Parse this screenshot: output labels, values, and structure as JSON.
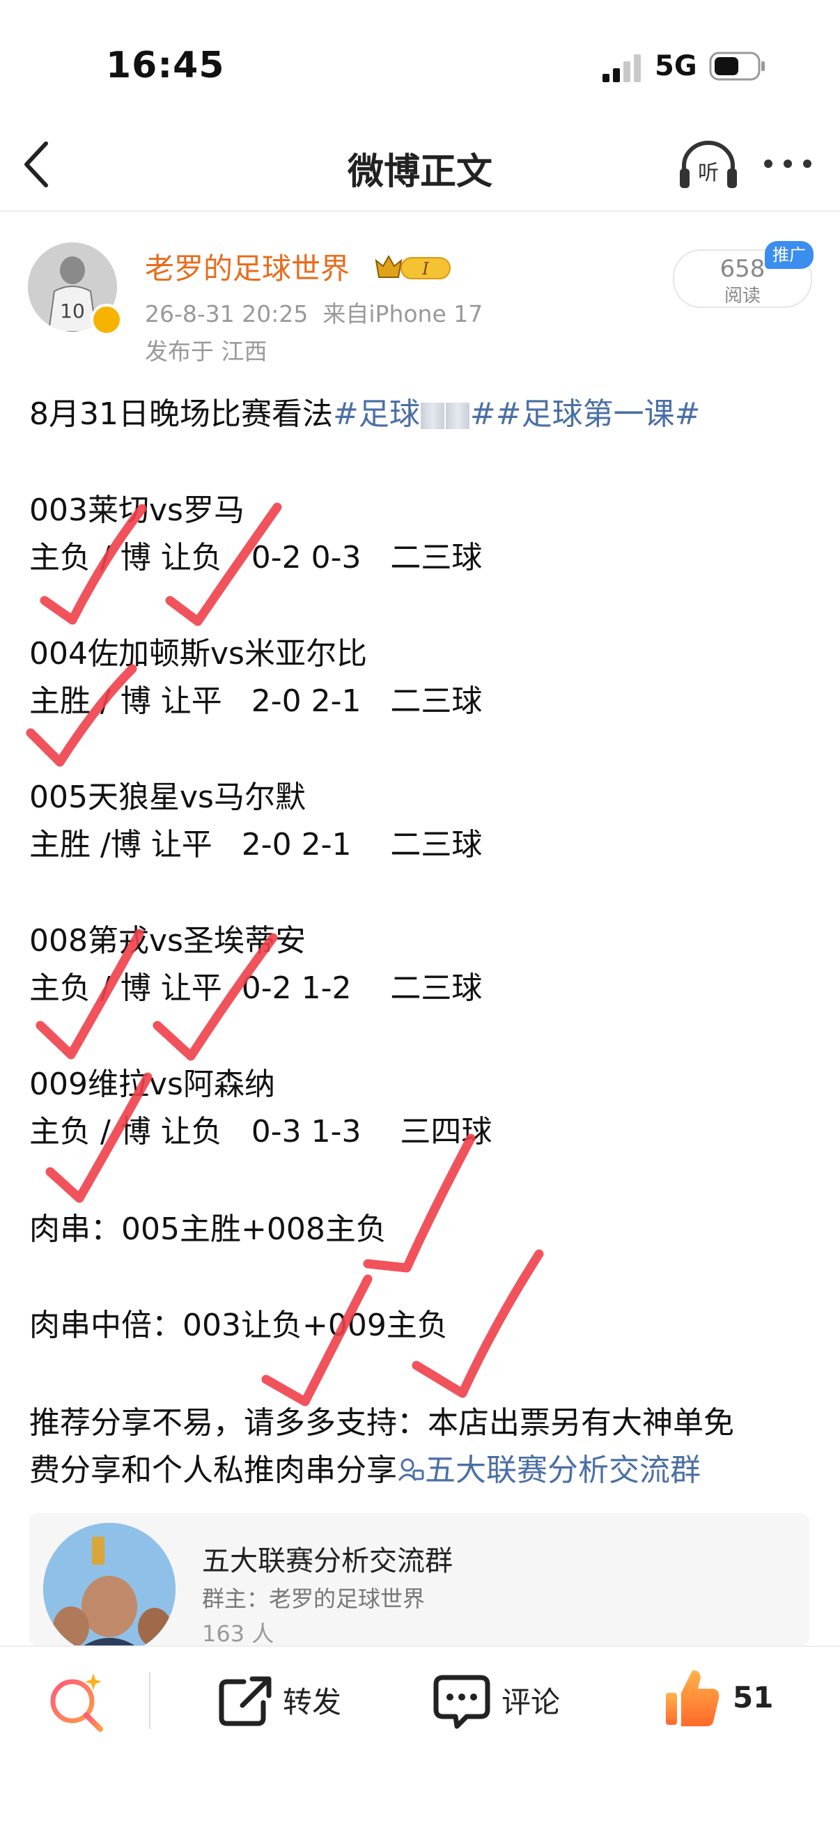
{
  "status_bar": {
    "time": "16:45",
    "network": "5G"
  },
  "nav": {
    "title": "微博正文"
  },
  "author": {
    "name": "老罗的足球世界",
    "vip_level": "I",
    "date": "26-8-31 20:25",
    "source": "来自iPhone 17",
    "location": "发布于 江西"
  },
  "stats": {
    "reads": "658",
    "reads_label": "阅读",
    "promo_badge": "推广"
  },
  "post": {
    "line1_text": "8月31日晚场比赛看法",
    "topic1": "#足球",
    "topic1_end": "#",
    "topic2": "#足球第一课#",
    "m003_title": "003莱切vs罗马",
    "m003_pick": "主负 / 博 让负   0-2 0-3   二三球",
    "m004_title": "004佐加顿斯vs米亚尔比",
    "m004_pick": "主胜 / 博 让平   2-0 2-1   二三球",
    "m005_title": "005天狼星vs马尔默",
    "m005_pick": "主胜 /博 让平   2-0 2-1    二三球",
    "m008_title": "008第戎vs圣埃蒂安",
    "m008_pick": "主负 / 博 让平  0-2 1-2    二三球",
    "m009_title": "009维拉vs阿森纳",
    "m009_pick": "主负 / 博 让负   0-3 1-3    三四球",
    "parlay": "肉串：005主胜+008主负",
    "parlay_mid": "肉串中倍：003让负+009主负",
    "share1": "推荐分享不易，请多多支持：本店出票另有大神单免",
    "share2": "费分享和个人私推肉串分享",
    "group_link": "五大联赛分析交流群"
  },
  "group_card": {
    "name": "五大联赛分析交流群",
    "owner": "群主：老罗的足球世界",
    "members": "163 人"
  },
  "actions": {
    "repost": "转发",
    "comment": "评论",
    "likes": "51"
  },
  "colors": {
    "author": "#e86c1c",
    "topic": "#4a6fa5",
    "check_mark": "#f0404a",
    "promo": "#3b8df0"
  }
}
